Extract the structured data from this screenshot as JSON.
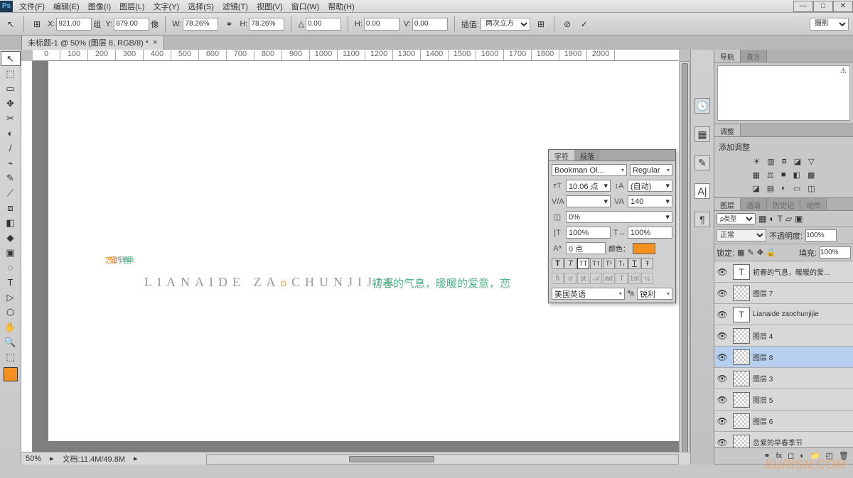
{
  "menu": {
    "items": [
      "文件(F)",
      "编辑(E)",
      "图像(I)",
      "图层(L)",
      "文字(Y)",
      "选择(S)",
      "滤镜(T)",
      "视图(V)",
      "窗口(W)",
      "帮助(H)"
    ]
  },
  "options": {
    "x": "921.00",
    "x_unit": "组",
    "y": "879.00",
    "y_unit": "像",
    "w": "78.26%",
    "link": "⚭",
    "h": "78.26%",
    "angle": "0.00",
    "hskew": "0.00",
    "vskew": "0.00",
    "interp": "两次立方",
    "preset_btn": "摄影"
  },
  "tab": {
    "title": "未标题-1 @ 50% (图层 8, RGB/8) *"
  },
  "ruler": [
    "0",
    "100",
    "200",
    "300",
    "400",
    "500",
    "600",
    "700",
    "800",
    "900",
    "1000",
    "1100",
    "1200",
    "1300",
    "1400",
    "1500",
    "1600",
    "1700",
    "1800",
    "1900",
    "2000"
  ],
  "tools": [
    "↖",
    "⬚",
    "▭",
    "✥",
    "✂",
    "◐",
    "/",
    "⌁",
    "✎",
    "⟋",
    "⧈",
    "◧",
    "◆",
    "▣",
    "◌",
    "✍",
    "T",
    "▷",
    "⬡",
    "✋",
    "🔍",
    "⬚"
  ],
  "status": {
    "zoom": "50%",
    "doc": "文档:11.4M/49.8M"
  },
  "art": {
    "main_cn": "恋爱的早春季",
    "pinyin": "LIANAIDE ZAOCHUNJIJIE",
    "sub": "初春的气息，暖暖的爱意，恋"
  },
  "char": {
    "tab1": "字符",
    "tab2": "段落",
    "font": "Bookman Ol...",
    "style": "Regular",
    "size": "10.06 点",
    "leading": "(自动)",
    "va": "",
    "tracking": "140",
    "scale": "0%",
    "vsc": "100%",
    "hsc": "100%",
    "baseline": "0 点",
    "color_label": "颜色：",
    "color": "#f39020",
    "lang": "美国英语",
    "aa": "锐利"
  },
  "nav": {
    "tab1": "导航",
    "tab2": "直方"
  },
  "adj": {
    "tab": "调整",
    "add": "添加调整"
  },
  "layers": {
    "tabs": [
      "图层",
      "通道",
      "历史记",
      "动作"
    ],
    "kind": "ρ类型",
    "blend": "正常",
    "opacity_lbl": "不透明度:",
    "opacity": "100%",
    "lock_lbl": "锁定:",
    "fill_lbl": "填充:",
    "fill": "100%",
    "items": [
      {
        "type": "T",
        "name": "初春的气息，暖暖的爱..."
      },
      {
        "type": "checker",
        "name": "图层 7"
      },
      {
        "type": "T",
        "name": "Lianaide zaochunjijie"
      },
      {
        "type": "checker",
        "name": "图层 4"
      },
      {
        "type": "checker",
        "name": "图层 8",
        "sel": true
      },
      {
        "type": "checker",
        "name": "图层 3"
      },
      {
        "type": "checker",
        "name": "图层 5"
      },
      {
        "type": "checker",
        "name": "图层 6"
      },
      {
        "type": "checker",
        "name": "恋爱的早春季节"
      }
    ]
  },
  "watermark": "XURISN.COM"
}
